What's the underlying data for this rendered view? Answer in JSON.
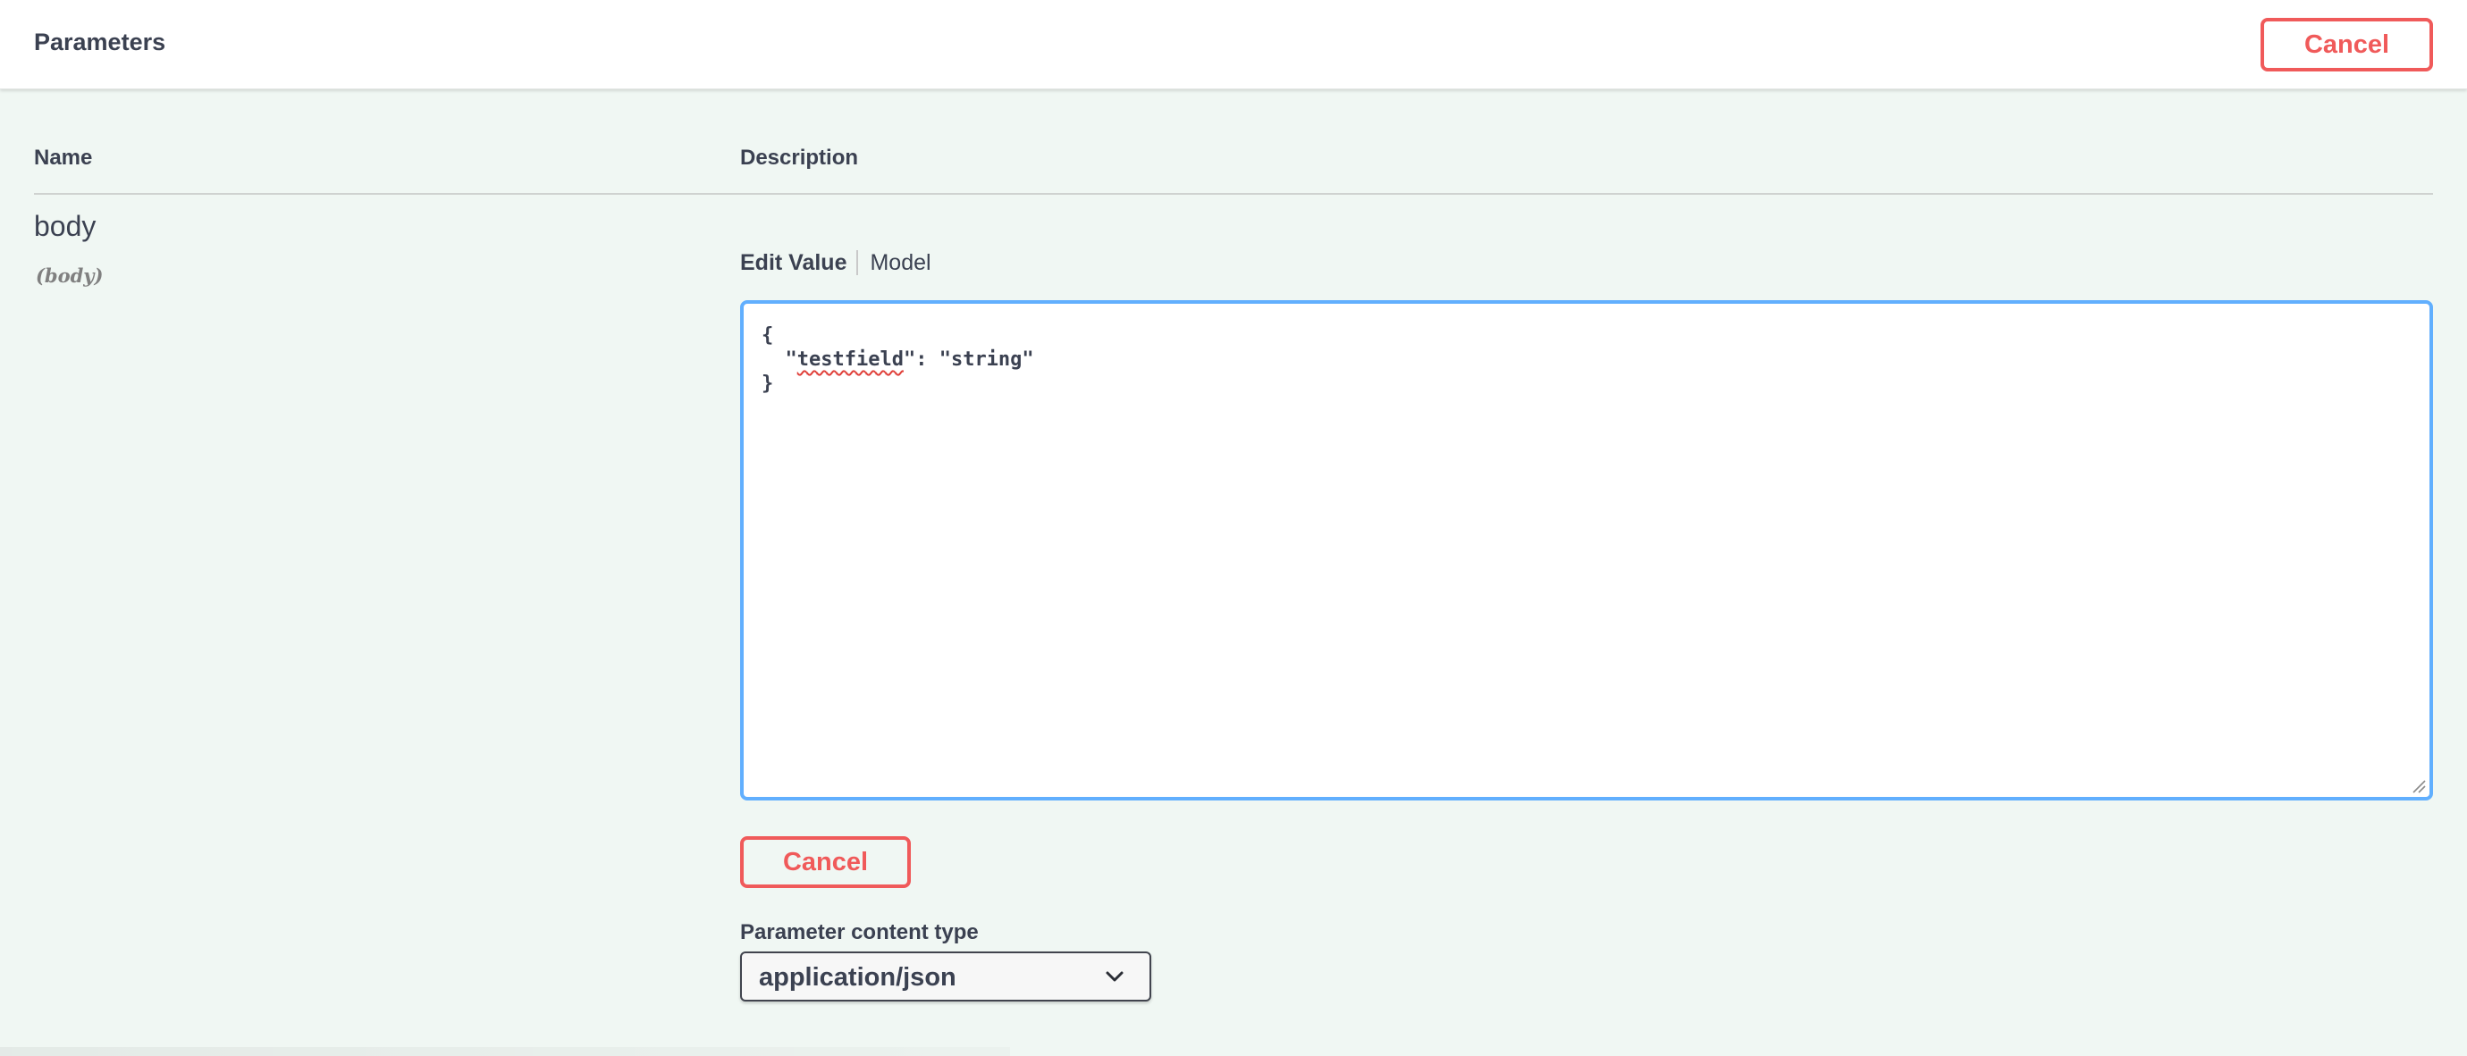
{
  "header": {
    "title": "Parameters",
    "cancel_label": "Cancel"
  },
  "table": {
    "col_name": "Name",
    "col_description": "Description"
  },
  "parameter": {
    "name": "body",
    "in": "(body)"
  },
  "tabs": [
    {
      "label": "Edit Value",
      "active": true
    },
    {
      "label": "Model",
      "active": false
    }
  ],
  "editor": {
    "line1": "{",
    "line2_indent": "  ",
    "line2_q1": "\"",
    "line2_key": "testfield",
    "line2_rest": "\": \"string\"",
    "line3": "}"
  },
  "body_cancel_label": "Cancel",
  "content_type": {
    "label": "Parameter content type",
    "selected": "application/json"
  },
  "colors": {
    "accent_blue": "#61affe",
    "cancel_red": "#f05a5a",
    "background": "#f0f7f3"
  },
  "icons": {
    "select_chevron": "chevron-down-icon",
    "resize": "resize-grip-icon"
  }
}
